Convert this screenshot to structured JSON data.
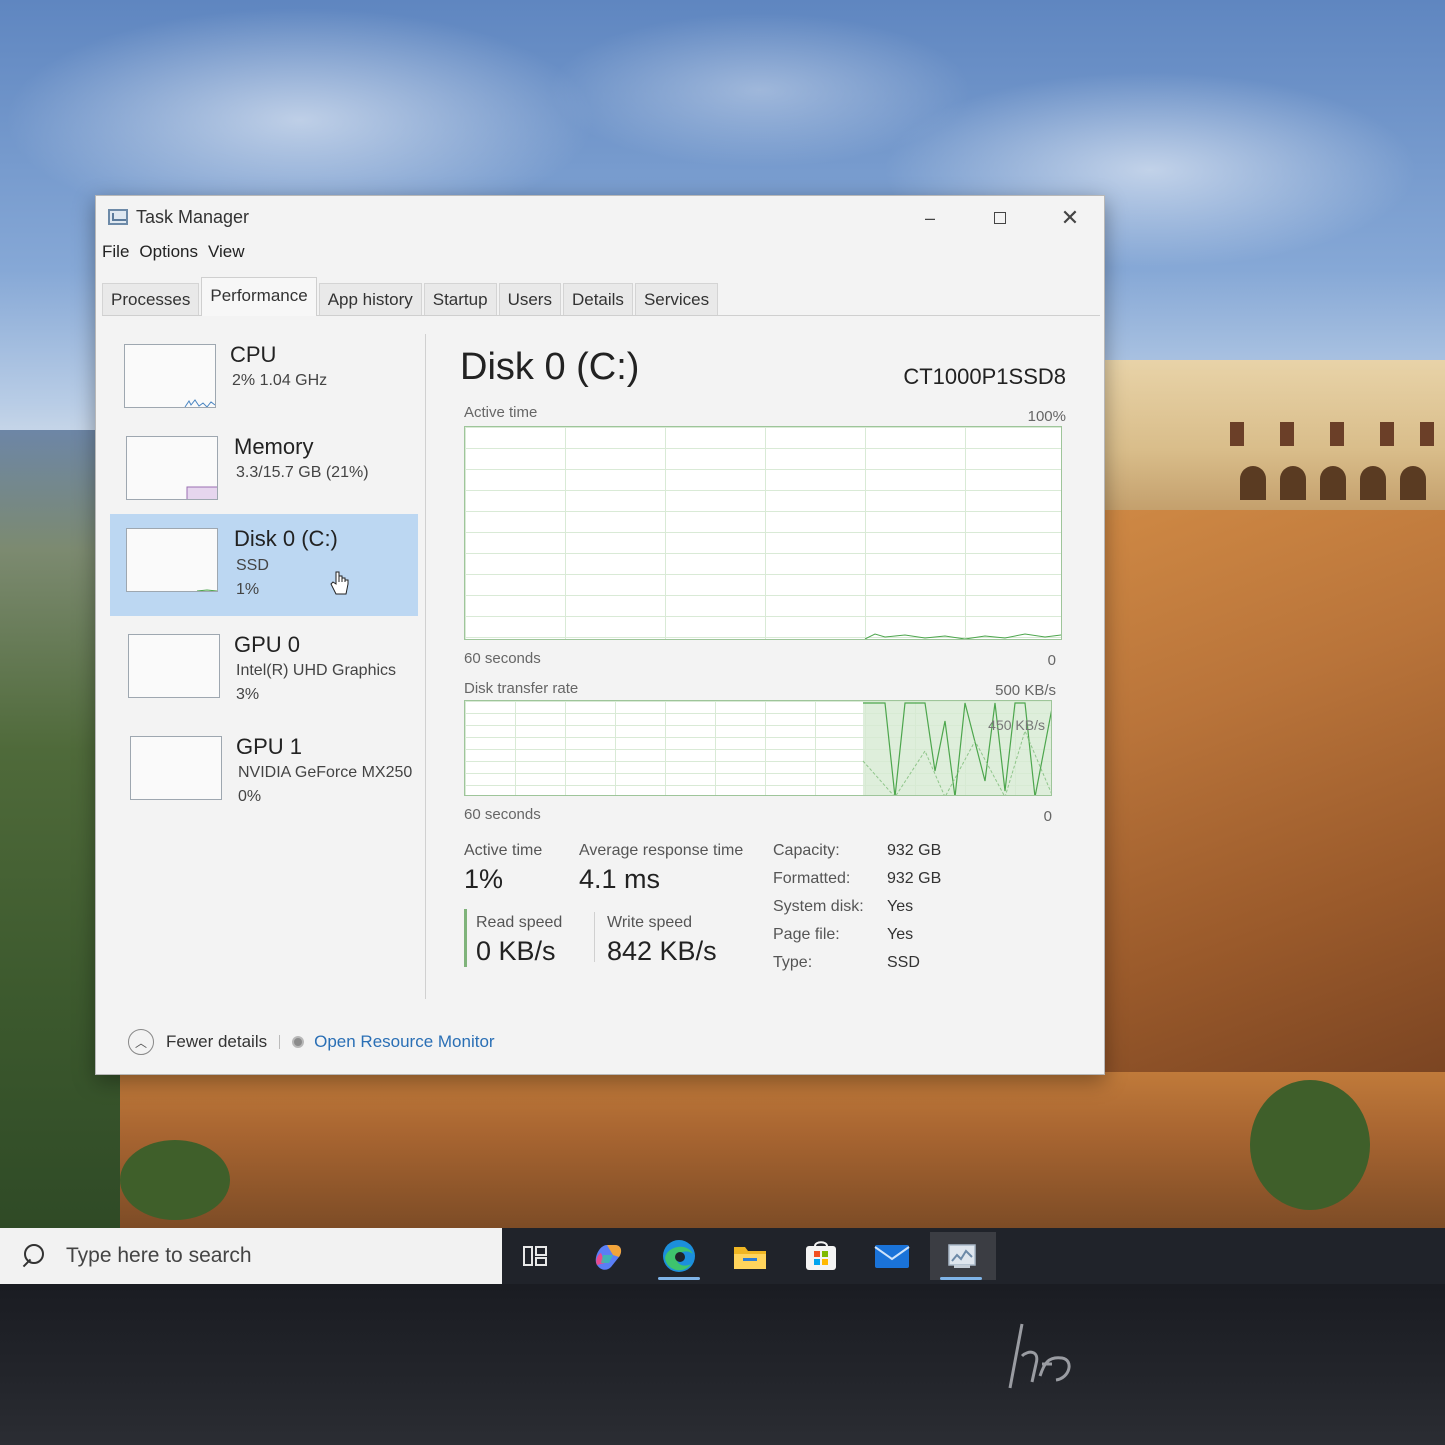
{
  "window": {
    "title": "Task Manager",
    "controls": {
      "minimize": "–",
      "close": "✕"
    }
  },
  "menu": [
    "File",
    "Options",
    "View"
  ],
  "tabs": [
    {
      "label": "Processes",
      "active": false
    },
    {
      "label": "Performance",
      "active": true
    },
    {
      "label": "App history",
      "active": false
    },
    {
      "label": "Startup",
      "active": false
    },
    {
      "label": "Users",
      "active": false
    },
    {
      "label": "Details",
      "active": false
    },
    {
      "label": "Services",
      "active": false
    }
  ],
  "sidebar": {
    "items": [
      {
        "title": "CPU",
        "line1": "2%  1.04 GHz",
        "line2": "",
        "selected": false
      },
      {
        "title": "Memory",
        "line1": "3.3/15.7 GB (21%)",
        "line2": "",
        "selected": false
      },
      {
        "title": "Disk 0 (C:)",
        "line1": "SSD",
        "line2": "1%",
        "selected": true
      },
      {
        "title": "GPU 0",
        "line1": "Intel(R) UHD Graphics",
        "line2": "3%",
        "selected": false
      },
      {
        "title": "GPU 1",
        "line1": "NVIDIA GeForce MX250",
        "line2": "0%",
        "selected": false
      }
    ]
  },
  "main": {
    "title": "Disk 0 (C:)",
    "model": "CT1000P1SSD8",
    "active_graph": {
      "label": "Active time",
      "max_label": "100%",
      "time_label": "60 seconds",
      "zero_label": "0"
    },
    "transfer_graph": {
      "label": "Disk transfer rate",
      "max_label": "500 KB/s",
      "mid_label": "450 KB/s",
      "time_label": "60 seconds",
      "zero_label": "0"
    },
    "stats": {
      "active_time_label": "Active time",
      "active_time_value": "1%",
      "avg_response_label": "Average response time",
      "avg_response_value": "4.1 ms",
      "read_speed_label": "Read speed",
      "read_speed_value": "0 KB/s",
      "write_speed_label": "Write speed",
      "write_speed_value": "842 KB/s"
    },
    "properties": [
      {
        "label": "Capacity:",
        "value": "932 GB"
      },
      {
        "label": "Formatted:",
        "value": "932 GB"
      },
      {
        "label": "System disk:",
        "value": "Yes"
      },
      {
        "label": "Page file:",
        "value": "Yes"
      },
      {
        "label": "Type:",
        "value": "SSD"
      }
    ]
  },
  "footer": {
    "fewer_details": "Fewer details",
    "open_resource_monitor": "Open Resource Monitor"
  },
  "taskbar": {
    "search_placeholder": "Type here to search",
    "apps": [
      {
        "name": "task-view-icon",
        "running": false
      },
      {
        "name": "copilot-icon",
        "running": false
      },
      {
        "name": "edge-icon",
        "running": true
      },
      {
        "name": "file-explorer-icon",
        "running": false
      },
      {
        "name": "microsoft-store-icon",
        "running": false
      },
      {
        "name": "mail-icon",
        "running": false
      },
      {
        "name": "task-manager-icon",
        "running": true,
        "active": true
      }
    ]
  },
  "colors": {
    "selection": "#bcd7f2",
    "graph_line": "#4da64d",
    "link": "#2a6fb5"
  }
}
